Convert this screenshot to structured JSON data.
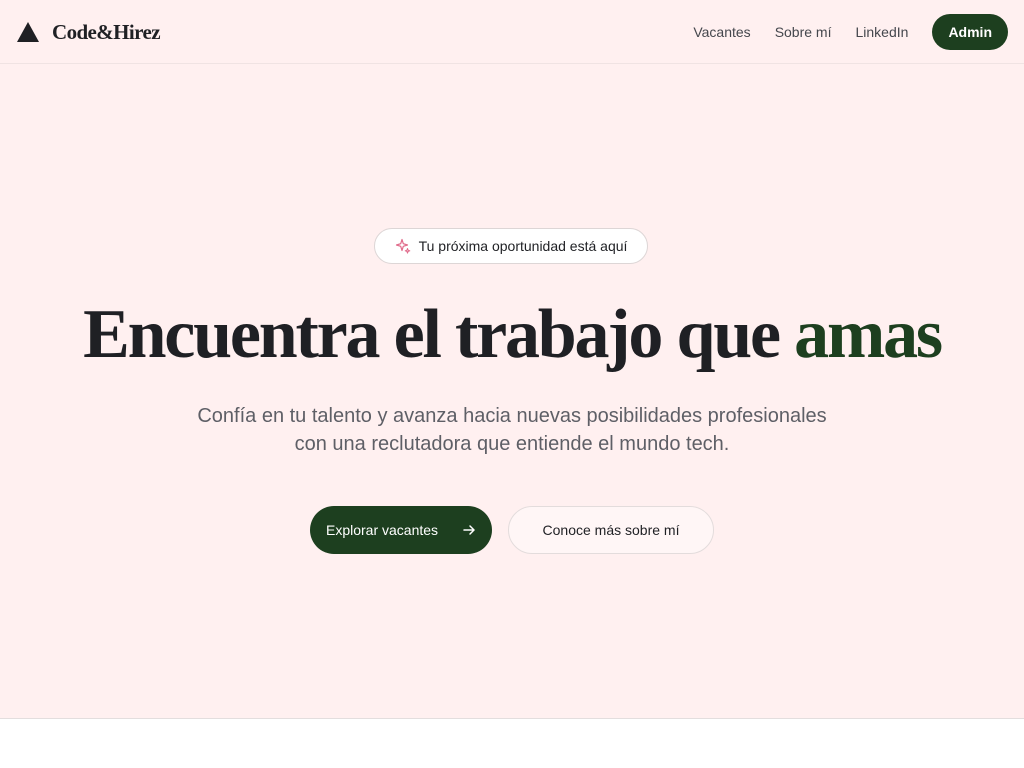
{
  "brand": {
    "name": "Code&Hirez",
    "logo_icon": "triangle-logo-icon"
  },
  "nav": {
    "links": [
      "Vacantes",
      "Sobre mí",
      "LinkedIn"
    ],
    "admin_label": "Admin"
  },
  "hero": {
    "badge_icon": "sparkle-icon",
    "badge_text": "Tu próxima oportunidad está aquí",
    "headline_main": "Encuentra el trabajo que ",
    "headline_accent": "amas",
    "subtitle_line1": "Confía en tu talento y avanza hacia nuevas posibilidades profesionales",
    "subtitle_line2": "con una reclutadora que entiende el mundo tech.",
    "primary_cta": "Explorar vacantes",
    "primary_cta_icon": "arrow-right-icon",
    "secondary_cta": "Conoce más sobre mí"
  },
  "colors": {
    "hero_background": "#fff0f0",
    "brand_green": "#1d3f1f",
    "text_dark": "#1f2024",
    "text_muted": "#5e5f66",
    "sparkle_pink": "#e06a8a"
  }
}
